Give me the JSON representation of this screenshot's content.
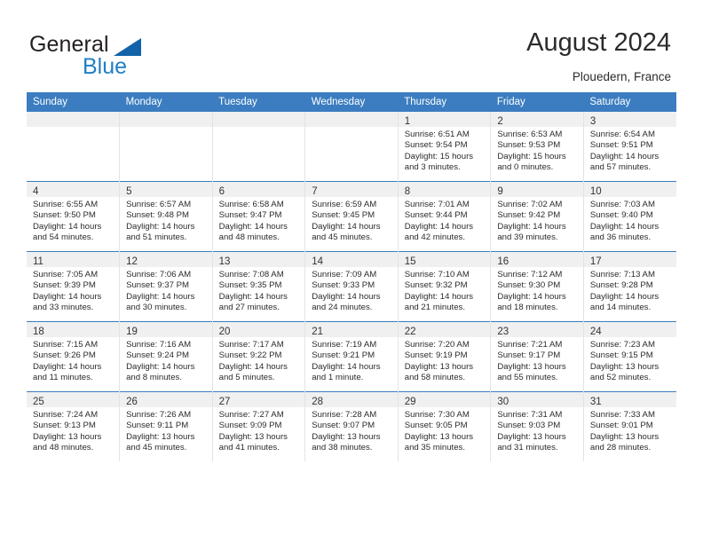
{
  "brand": {
    "name_part1": "General",
    "name_part2": "Blue",
    "triangle_color": "#1263a8",
    "blue_color": "#1f7fc4"
  },
  "header": {
    "title": "August 2024",
    "location": "Plouedern, France",
    "header_bg": "#3b7dc0",
    "header_text_color": "#ffffff"
  },
  "weekdays": [
    "Sunday",
    "Monday",
    "Tuesday",
    "Wednesday",
    "Thursday",
    "Friday",
    "Saturday"
  ],
  "calendar_data": {
    "month": "August",
    "year": 2024,
    "location": "Plouedern, France",
    "first_day_column": 4,
    "days_in_month": 31,
    "weeks": [
      [
        {
          "day": "",
          "sunrise": "",
          "sunset": "",
          "daylight_line1": "",
          "daylight_line2": ""
        },
        {
          "day": "",
          "sunrise": "",
          "sunset": "",
          "daylight_line1": "",
          "daylight_line2": ""
        },
        {
          "day": "",
          "sunrise": "",
          "sunset": "",
          "daylight_line1": "",
          "daylight_line2": ""
        },
        {
          "day": "",
          "sunrise": "",
          "sunset": "",
          "daylight_line1": "",
          "daylight_line2": ""
        },
        {
          "day": "1",
          "sunrise": "Sunrise: 6:51 AM",
          "sunset": "Sunset: 9:54 PM",
          "daylight_line1": "Daylight: 15 hours",
          "daylight_line2": "and 3 minutes."
        },
        {
          "day": "2",
          "sunrise": "Sunrise: 6:53 AM",
          "sunset": "Sunset: 9:53 PM",
          "daylight_line1": "Daylight: 15 hours",
          "daylight_line2": "and 0 minutes."
        },
        {
          "day": "3",
          "sunrise": "Sunrise: 6:54 AM",
          "sunset": "Sunset: 9:51 PM",
          "daylight_line1": "Daylight: 14 hours",
          "daylight_line2": "and 57 minutes."
        }
      ],
      [
        {
          "day": "4",
          "sunrise": "Sunrise: 6:55 AM",
          "sunset": "Sunset: 9:50 PM",
          "daylight_line1": "Daylight: 14 hours",
          "daylight_line2": "and 54 minutes."
        },
        {
          "day": "5",
          "sunrise": "Sunrise: 6:57 AM",
          "sunset": "Sunset: 9:48 PM",
          "daylight_line1": "Daylight: 14 hours",
          "daylight_line2": "and 51 minutes."
        },
        {
          "day": "6",
          "sunrise": "Sunrise: 6:58 AM",
          "sunset": "Sunset: 9:47 PM",
          "daylight_line1": "Daylight: 14 hours",
          "daylight_line2": "and 48 minutes."
        },
        {
          "day": "7",
          "sunrise": "Sunrise: 6:59 AM",
          "sunset": "Sunset: 9:45 PM",
          "daylight_line1": "Daylight: 14 hours",
          "daylight_line2": "and 45 minutes."
        },
        {
          "day": "8",
          "sunrise": "Sunrise: 7:01 AM",
          "sunset": "Sunset: 9:44 PM",
          "daylight_line1": "Daylight: 14 hours",
          "daylight_line2": "and 42 minutes."
        },
        {
          "day": "9",
          "sunrise": "Sunrise: 7:02 AM",
          "sunset": "Sunset: 9:42 PM",
          "daylight_line1": "Daylight: 14 hours",
          "daylight_line2": "and 39 minutes."
        },
        {
          "day": "10",
          "sunrise": "Sunrise: 7:03 AM",
          "sunset": "Sunset: 9:40 PM",
          "daylight_line1": "Daylight: 14 hours",
          "daylight_line2": "and 36 minutes."
        }
      ],
      [
        {
          "day": "11",
          "sunrise": "Sunrise: 7:05 AM",
          "sunset": "Sunset: 9:39 PM",
          "daylight_line1": "Daylight: 14 hours",
          "daylight_line2": "and 33 minutes."
        },
        {
          "day": "12",
          "sunrise": "Sunrise: 7:06 AM",
          "sunset": "Sunset: 9:37 PM",
          "daylight_line1": "Daylight: 14 hours",
          "daylight_line2": "and 30 minutes."
        },
        {
          "day": "13",
          "sunrise": "Sunrise: 7:08 AM",
          "sunset": "Sunset: 9:35 PM",
          "daylight_line1": "Daylight: 14 hours",
          "daylight_line2": "and 27 minutes."
        },
        {
          "day": "14",
          "sunrise": "Sunrise: 7:09 AM",
          "sunset": "Sunset: 9:33 PM",
          "daylight_line1": "Daylight: 14 hours",
          "daylight_line2": "and 24 minutes."
        },
        {
          "day": "15",
          "sunrise": "Sunrise: 7:10 AM",
          "sunset": "Sunset: 9:32 PM",
          "daylight_line1": "Daylight: 14 hours",
          "daylight_line2": "and 21 minutes."
        },
        {
          "day": "16",
          "sunrise": "Sunrise: 7:12 AM",
          "sunset": "Sunset: 9:30 PM",
          "daylight_line1": "Daylight: 14 hours",
          "daylight_line2": "and 18 minutes."
        },
        {
          "day": "17",
          "sunrise": "Sunrise: 7:13 AM",
          "sunset": "Sunset: 9:28 PM",
          "daylight_line1": "Daylight: 14 hours",
          "daylight_line2": "and 14 minutes."
        }
      ],
      [
        {
          "day": "18",
          "sunrise": "Sunrise: 7:15 AM",
          "sunset": "Sunset: 9:26 PM",
          "daylight_line1": "Daylight: 14 hours",
          "daylight_line2": "and 11 minutes."
        },
        {
          "day": "19",
          "sunrise": "Sunrise: 7:16 AM",
          "sunset": "Sunset: 9:24 PM",
          "daylight_line1": "Daylight: 14 hours",
          "daylight_line2": "and 8 minutes."
        },
        {
          "day": "20",
          "sunrise": "Sunrise: 7:17 AM",
          "sunset": "Sunset: 9:22 PM",
          "daylight_line1": "Daylight: 14 hours",
          "daylight_line2": "and 5 minutes."
        },
        {
          "day": "21",
          "sunrise": "Sunrise: 7:19 AM",
          "sunset": "Sunset: 9:21 PM",
          "daylight_line1": "Daylight: 14 hours",
          "daylight_line2": "and 1 minute."
        },
        {
          "day": "22",
          "sunrise": "Sunrise: 7:20 AM",
          "sunset": "Sunset: 9:19 PM",
          "daylight_line1": "Daylight: 13 hours",
          "daylight_line2": "and 58 minutes."
        },
        {
          "day": "23",
          "sunrise": "Sunrise: 7:21 AM",
          "sunset": "Sunset: 9:17 PM",
          "daylight_line1": "Daylight: 13 hours",
          "daylight_line2": "and 55 minutes."
        },
        {
          "day": "24",
          "sunrise": "Sunrise: 7:23 AM",
          "sunset": "Sunset: 9:15 PM",
          "daylight_line1": "Daylight: 13 hours",
          "daylight_line2": "and 52 minutes."
        }
      ],
      [
        {
          "day": "25",
          "sunrise": "Sunrise: 7:24 AM",
          "sunset": "Sunset: 9:13 PM",
          "daylight_line1": "Daylight: 13 hours",
          "daylight_line2": "and 48 minutes."
        },
        {
          "day": "26",
          "sunrise": "Sunrise: 7:26 AM",
          "sunset": "Sunset: 9:11 PM",
          "daylight_line1": "Daylight: 13 hours",
          "daylight_line2": "and 45 minutes."
        },
        {
          "day": "27",
          "sunrise": "Sunrise: 7:27 AM",
          "sunset": "Sunset: 9:09 PM",
          "daylight_line1": "Daylight: 13 hours",
          "daylight_line2": "and 41 minutes."
        },
        {
          "day": "28",
          "sunrise": "Sunrise: 7:28 AM",
          "sunset": "Sunset: 9:07 PM",
          "daylight_line1": "Daylight: 13 hours",
          "daylight_line2": "and 38 minutes."
        },
        {
          "day": "29",
          "sunrise": "Sunrise: 7:30 AM",
          "sunset": "Sunset: 9:05 PM",
          "daylight_line1": "Daylight: 13 hours",
          "daylight_line2": "and 35 minutes."
        },
        {
          "day": "30",
          "sunrise": "Sunrise: 7:31 AM",
          "sunset": "Sunset: 9:03 PM",
          "daylight_line1": "Daylight: 13 hours",
          "daylight_line2": "and 31 minutes."
        },
        {
          "day": "31",
          "sunrise": "Sunrise: 7:33 AM",
          "sunset": "Sunset: 9:01 PM",
          "daylight_line1": "Daylight: 13 hours",
          "daylight_line2": "and 28 minutes."
        }
      ]
    ]
  }
}
